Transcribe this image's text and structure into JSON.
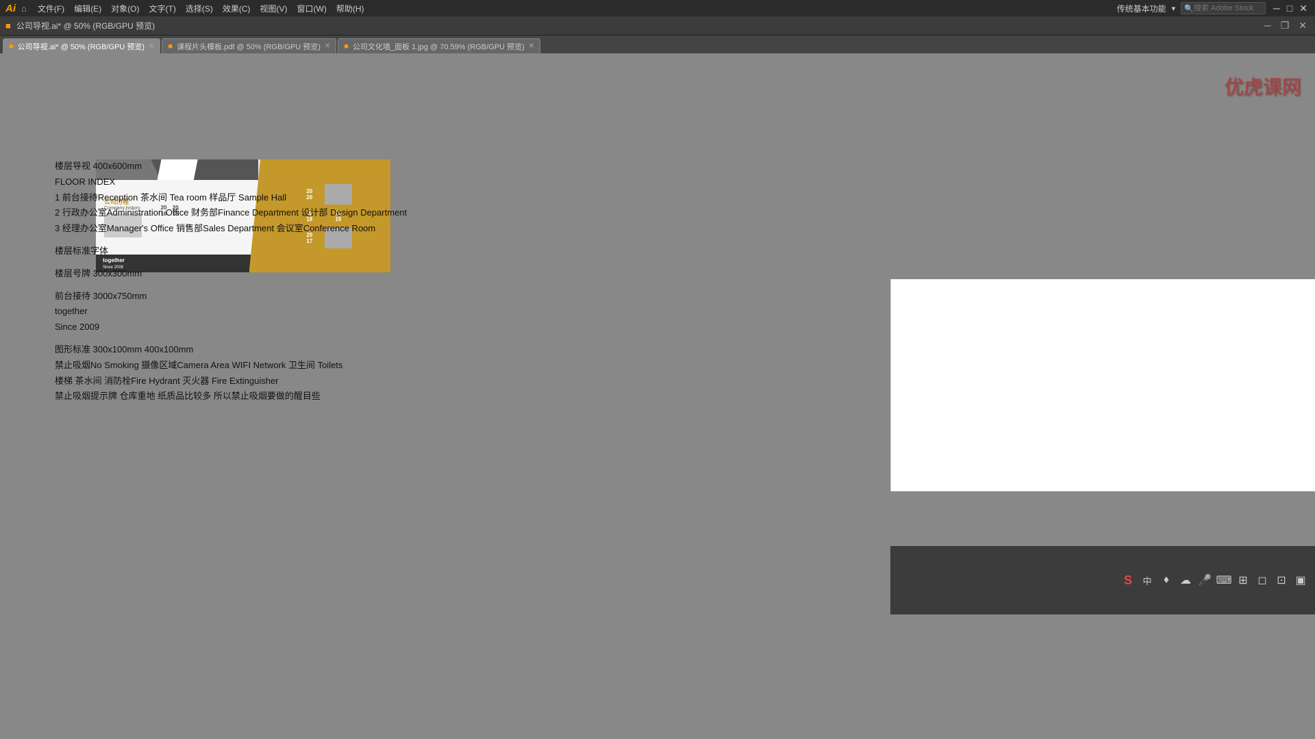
{
  "app": {
    "logo": "Ai",
    "home_icon": "⌂",
    "search_placeholder": "搜索 Adobe Stock"
  },
  "menubar": {
    "items": [
      {
        "label": "文件(F)"
      },
      {
        "label": "编辑(E)"
      },
      {
        "label": "对象(O)"
      },
      {
        "label": "文字(T)"
      },
      {
        "label": "选择(S)"
      },
      {
        "label": "效果(C)"
      },
      {
        "label": "视图(V)"
      },
      {
        "label": "窗口(W)"
      },
      {
        "label": "帮助(H)"
      }
    ],
    "traditional_basic": "传统基本功能",
    "dropdown_icon": "▾",
    "window_min": "─",
    "window_max": "□",
    "window_close": "✕"
  },
  "titlebar": {
    "title": "公司导视.ai* @ 50% (RGB/GPU 预览)",
    "min": "─",
    "restore": "❐",
    "close": "✕"
  },
  "tabs": [
    {
      "label": "公司导视.ai* @ 50% (RGB/GPU 预览)",
      "active": true,
      "closable": true
    },
    {
      "label": "课程片头模板.pdf @ 50% (RGB/GPU 预览)",
      "active": false,
      "closable": true
    },
    {
      "label": "公司文化墙_面板 1.jpg @ 70.59% (RGB/GPU 预览)",
      "active": false,
      "closable": true
    }
  ],
  "watermark": "优虎课网",
  "design_preview": {
    "company_hist_cn": "公司历程",
    "company_hist_en": "Company history",
    "together": "together",
    "since": "Since 2008",
    "years": [
      "20\n20",
      "20\n16",
      "20\n18",
      "20\n19",
      "20\n17"
    ]
  },
  "content": {
    "floor_guide_size": "楼层导视 400x600mm",
    "floor_index_title": "FLOOR INDEX",
    "floor_1": "1  前台接待Reception  茶水间 Tea room 样品厅 Sample Hall",
    "floor_2": "2 行政办公室Administration Office 财务部Finance Department 设计部 Design Department",
    "floor_3": "3 经理办公室Manager's Office 销售部Sales Department 会议室Conference Room",
    "floor_font": "楼层标准字体",
    "floor_badge_size": "楼层号牌 300x300mm",
    "reception_size": "前台接待 3000x750mm",
    "together_label": "together",
    "since_label": "Since 2009",
    "graphic_standard": "图形标准 300x100mm  400x100mm",
    "no_smoking": "禁止吸烟No Smoking 摄像区域Camera Area WIFI Network 卫生间 Toilets",
    "other_signs": "楼梯 茶水间 消防栓Fire Hydrant 灭火器 Fire Extinguisher",
    "note": "禁止吸烟提示牌 仓库重地 纸质品比较多 所以禁止吸烟要做的醒目些"
  },
  "taskbar": {
    "icons": [
      "S",
      "中",
      "♦",
      "☁",
      "🎤",
      "⌨",
      "⊞",
      "◻",
      "⊡",
      "▣"
    ]
  }
}
